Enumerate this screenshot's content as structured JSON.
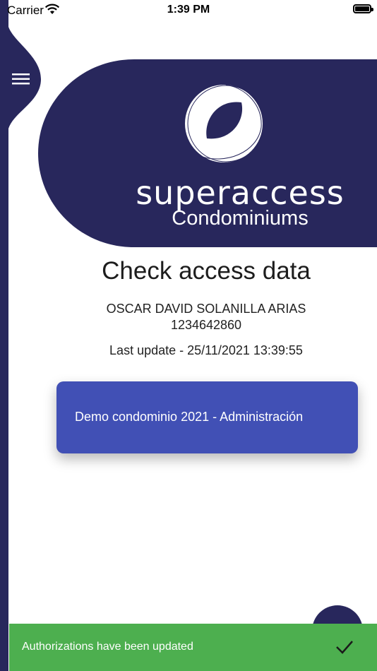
{
  "status_bar": {
    "carrier": "Carrier",
    "time": "1:39 PM"
  },
  "brand": {
    "name": "superaccess",
    "subtitle": "Condominiums"
  },
  "page": {
    "title": "Check access data",
    "user_name": "OSCAR DAVID SOLANILLA ARIAS",
    "user_id": "1234642860",
    "last_update": "Last update - 25/11/2021 13:39:55"
  },
  "access_list": [
    {
      "label": "Demo condominio 2021 - Administración"
    }
  ],
  "snackbar": {
    "message": "Authorizations have been updated",
    "icon": "check-icon"
  },
  "icons": {
    "menu": "hamburger-menu-icon",
    "wifi": "wifi-icon",
    "battery": "battery-icon",
    "logo": "superaccess-logo-icon"
  },
  "colors": {
    "brand_navy": "#28275c",
    "card_blue": "#4150b5",
    "snackbar_green": "#4daf4f"
  }
}
